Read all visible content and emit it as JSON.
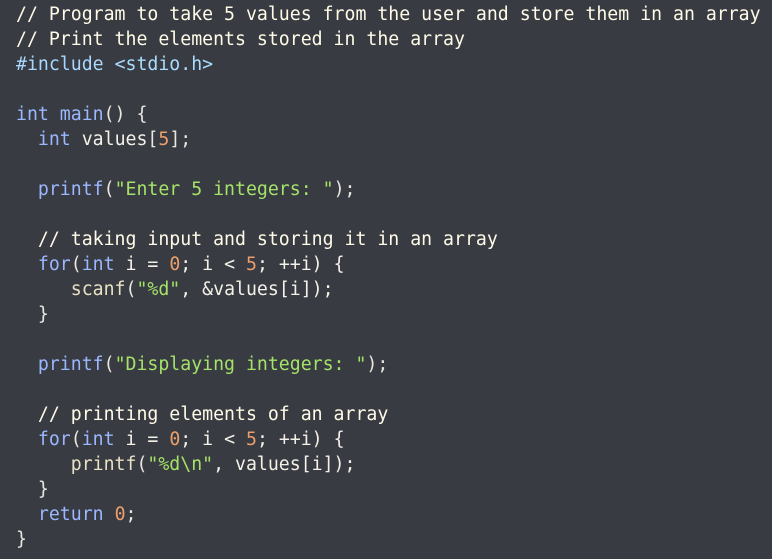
{
  "code": {
    "lines": [
      [
        {
          "t": "// Program to take 5 values from the user and store them in an array",
          "c": "comment"
        }
      ],
      [
        {
          "t": "// Print the elements stored in the array",
          "c": "comment"
        }
      ],
      [
        {
          "t": "#include ",
          "c": "pre"
        },
        {
          "t": "<stdio.h>",
          "c": "hdr"
        }
      ],
      [],
      [
        {
          "t": "int",
          "c": "kw"
        },
        {
          "t": " main",
          "c": "kw"
        },
        {
          "t": "() {",
          "c": "punc"
        }
      ],
      [
        {
          "t": "  ",
          "c": "punc"
        },
        {
          "t": "int",
          "c": "kw"
        },
        {
          "t": " values",
          "c": "ident"
        },
        {
          "t": "[",
          "c": "punc"
        },
        {
          "t": "5",
          "c": "num"
        },
        {
          "t": "];",
          "c": "punc"
        }
      ],
      [],
      [
        {
          "t": "  ",
          "c": "punc"
        },
        {
          "t": "printf",
          "c": "kw"
        },
        {
          "t": "(",
          "c": "punc"
        },
        {
          "t": "\"Enter 5 integers: \"",
          "c": "str"
        },
        {
          "t": ");",
          "c": "punc"
        }
      ],
      [],
      [
        {
          "t": "  ",
          "c": "punc"
        },
        {
          "t": "// taking input and storing it in an array",
          "c": "comment"
        }
      ],
      [
        {
          "t": "  ",
          "c": "punc"
        },
        {
          "t": "for",
          "c": "kw"
        },
        {
          "t": "(",
          "c": "punc"
        },
        {
          "t": "int",
          "c": "kw"
        },
        {
          "t": " i = ",
          "c": "ident"
        },
        {
          "t": "0",
          "c": "num"
        },
        {
          "t": "; i < ",
          "c": "ident"
        },
        {
          "t": "5",
          "c": "num"
        },
        {
          "t": "; ++i) {",
          "c": "ident"
        }
      ],
      [
        {
          "t": "     ",
          "c": "punc"
        },
        {
          "t": "scanf",
          "c": "fn"
        },
        {
          "t": "(",
          "c": "punc"
        },
        {
          "t": "\"%d\"",
          "c": "str"
        },
        {
          "t": ", &values[i]);",
          "c": "ident"
        }
      ],
      [
        {
          "t": "  }",
          "c": "punc"
        }
      ],
      [],
      [
        {
          "t": "  ",
          "c": "punc"
        },
        {
          "t": "printf",
          "c": "kw"
        },
        {
          "t": "(",
          "c": "punc"
        },
        {
          "t": "\"Displaying integers: \"",
          "c": "str"
        },
        {
          "t": ");",
          "c": "punc"
        }
      ],
      [],
      [
        {
          "t": "  ",
          "c": "punc"
        },
        {
          "t": "// printing elements of an array",
          "c": "comment"
        }
      ],
      [
        {
          "t": "  ",
          "c": "punc"
        },
        {
          "t": "for",
          "c": "kw"
        },
        {
          "t": "(",
          "c": "punc"
        },
        {
          "t": "int",
          "c": "kw"
        },
        {
          "t": " i = ",
          "c": "ident"
        },
        {
          "t": "0",
          "c": "num"
        },
        {
          "t": "; i < ",
          "c": "ident"
        },
        {
          "t": "5",
          "c": "num"
        },
        {
          "t": "; ++i) {",
          "c": "ident"
        }
      ],
      [
        {
          "t": "     ",
          "c": "punc"
        },
        {
          "t": "printf",
          "c": "fn"
        },
        {
          "t": "(",
          "c": "punc"
        },
        {
          "t": "\"%d\\n\"",
          "c": "str"
        },
        {
          "t": ", values[i]);",
          "c": "ident"
        }
      ],
      [
        {
          "t": "  }",
          "c": "punc"
        }
      ],
      [
        {
          "t": "  ",
          "c": "punc"
        },
        {
          "t": "return",
          "c": "kw"
        },
        {
          "t": " ",
          "c": "punc"
        },
        {
          "t": "0",
          "c": "num"
        },
        {
          "t": ";",
          "c": "punc"
        }
      ],
      [
        {
          "t": "}",
          "c": "punc"
        }
      ]
    ]
  },
  "colors": {
    "background": "#383b41",
    "comment": "#fffbe8",
    "keyword": "#9bb7ff",
    "number": "#eb9f6b",
    "string": "#a5e26a"
  }
}
